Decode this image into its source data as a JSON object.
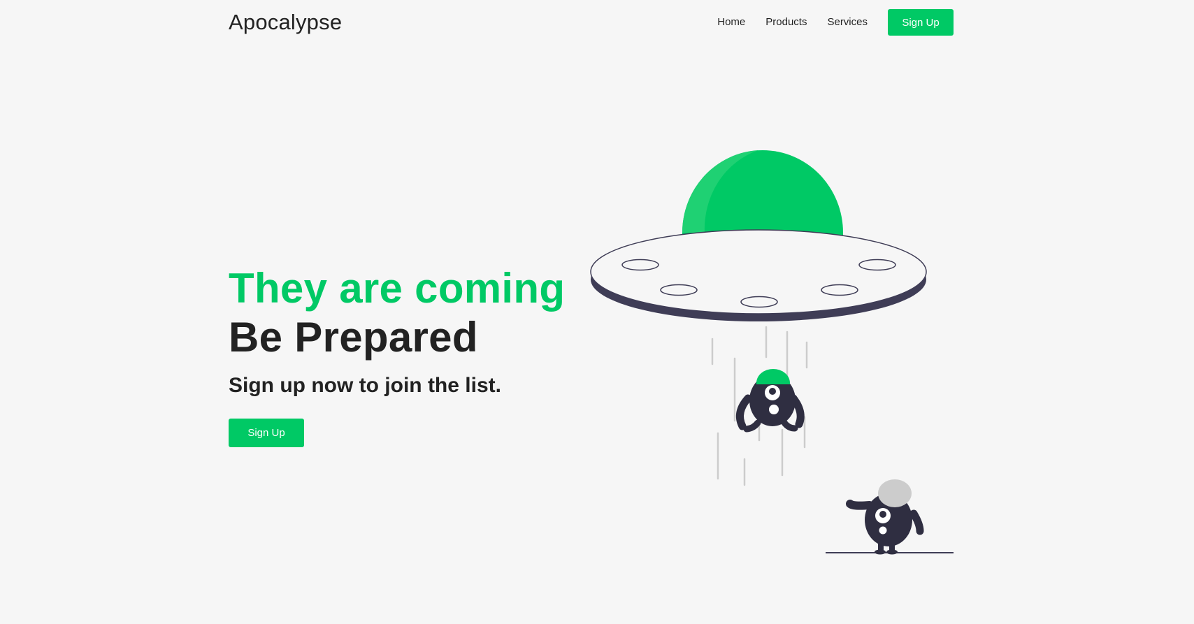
{
  "brand": {
    "name": "Apocalypse"
  },
  "nav": {
    "items": [
      {
        "label": "Home"
      },
      {
        "label": "Products"
      },
      {
        "label": "Services"
      }
    ],
    "signup_label": "Sign Up"
  },
  "hero": {
    "headline_line1": "They are coming",
    "headline_line2": "Be Prepared",
    "subheadline": "Sign up now to join the list.",
    "signup_label": "Sign Up"
  },
  "illustration": {
    "subject": "ufo-abducting-alien",
    "colors": {
      "accent": "#00c965",
      "accent_light": "#1fd173",
      "dark": "#2f2e41",
      "saucer_rim": "#3f3d56",
      "saucer_top": "#f6f6f6",
      "beam": "#cccccc",
      "stone": "#cccccc"
    }
  },
  "colors": {
    "background": "#f6f6f6",
    "accent": "#00c965",
    "text": "#222222"
  }
}
